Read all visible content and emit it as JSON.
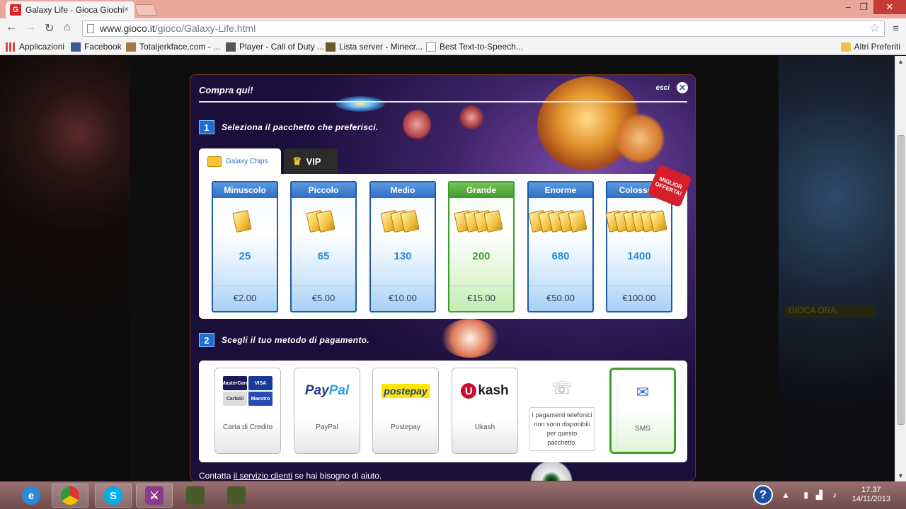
{
  "browser": {
    "tab_title": "Galaxy Life - Gioca Giochi",
    "tab_close": "×",
    "favicon": "G",
    "url": "www.gioco.it/gioco/Galaxy-Life.html",
    "url_domain": "www.gioco.it",
    "url_path": "/gioco/Galaxy-Life.html",
    "window_min": "–",
    "window_max": "❐",
    "window_close": "✕",
    "nav_back": "←",
    "nav_forward": "→",
    "nav_reload": "↻",
    "nav_home": "⌂",
    "star": "☆",
    "menu": "≡",
    "bookmarks": [
      {
        "label": "Applicazioni",
        "icon": "apps-icon"
      },
      {
        "label": "Facebook",
        "icon": "facebook-icon"
      },
      {
        "label": "Totaljerkface.com - ...",
        "icon": "site-icon"
      },
      {
        "label": "Player - Call of Duty ...",
        "icon": "site-icon"
      },
      {
        "label": "Lista server - Minecr...",
        "icon": "site-icon"
      },
      {
        "label": "Best Text-to-Speech...",
        "icon": "page-icon"
      }
    ],
    "other_bookmarks": "Altri Preferiti"
  },
  "modal": {
    "title": "Compra qui!",
    "exit_label": "esci",
    "close": "✕",
    "step1": {
      "num": "1",
      "text": "Seleziona il pacchetto che preferisci."
    },
    "step2": {
      "num": "2",
      "text": "Scegli il tuo metodo di pagamento."
    },
    "tabs": [
      {
        "label": "Galaxy Chips",
        "active": true
      },
      {
        "label": "VIP",
        "active": false
      }
    ],
    "best_offer": "MIGLIOR OFFERTA!",
    "packages": [
      {
        "name": "Minuscolo",
        "amount": "25",
        "price": "€2.00",
        "selected": false
      },
      {
        "name": "Piccolo",
        "amount": "65",
        "price": "€5.00",
        "selected": false
      },
      {
        "name": "Medio",
        "amount": "130",
        "price": "€10.00",
        "selected": false
      },
      {
        "name": "Grande",
        "amount": "200",
        "price": "€15.00",
        "selected": true
      },
      {
        "name": "Enorme",
        "amount": "680",
        "price": "€50.00",
        "selected": false
      },
      {
        "name": "Colossale",
        "amount": "1400",
        "price": "€100.00",
        "selected": false
      }
    ],
    "payments": [
      {
        "label": "Carta di Credito",
        "logo": "credit-card-logos"
      },
      {
        "label": "PayPal",
        "logo": "paypal-logo"
      },
      {
        "label": "Postepay",
        "logo": "postepay-logo"
      },
      {
        "label": "Ukash",
        "logo": "ukash-logo"
      },
      {
        "label": "",
        "note": "I pagamenti telefonici non sono disponibili per questo pacchetto.",
        "logo": "phone-icon"
      },
      {
        "label": "SMS",
        "logo": "sms-icon",
        "selected": true
      }
    ],
    "card_logos": [
      "MasterCard",
      "VISA",
      "CartaSi",
      "Maestro"
    ],
    "paypal_a": "Pay",
    "paypal_b": "Pal",
    "postepay_text": "postepay",
    "ukash_u": "U",
    "ukash_text": "kash",
    "footer_pre": "Contatta ",
    "footer_link": "il servizio clienti",
    "footer_post": " se hai bisogno di aiuto."
  },
  "side_right": {
    "play_label": "GIOCA ORA"
  },
  "taskbar": {
    "time": "17.37",
    "date": "14/11/2013",
    "help": "?",
    "apps": [
      "internet-explorer-icon",
      "chrome-icon",
      "skype-icon",
      "game-icon",
      "minecraft-icon",
      "minecraft-icon"
    ]
  }
}
